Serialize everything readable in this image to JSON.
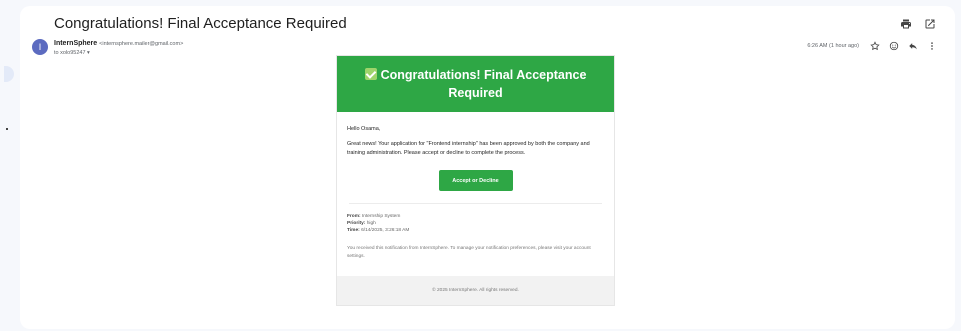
{
  "mail": {
    "subject": "Congratulations! Final Acceptance Required",
    "sender_name": "InternSphere",
    "sender_email": "<internsphere.mailer@gmail.com>",
    "avatar_letter": "I",
    "to_line": "to xolo95247 ▾",
    "timestamp": "6:26 AM (1 hour ago)"
  },
  "icons": {
    "print": "print-icon",
    "open_new": "open-in-new-window-icon",
    "star": "star-icon",
    "emoji": "emoji-icon",
    "reply": "reply-icon",
    "more": "more-vert-icon"
  },
  "email": {
    "header_title": "Congratulations! Final Acceptance Required",
    "greeting": "Hello Osama,",
    "message": "Great news! Your application for \"Frontend internship\" has been approved by both the company and training administration. Please accept or decline to complete the process.",
    "cta_label": "Accept or Decline",
    "from_label": "From:",
    "from_value": "Internship System",
    "priority_label": "Priority:",
    "priority_value": "high",
    "time_label": "Time:",
    "time_value": "6/14/2025, 3:26:18 AM",
    "note": "You received this notification from InternSphere. To manage your notification preferences, please visit your account settings.",
    "footer": "© 2025 InternSphere. All rights reserved."
  },
  "colors": {
    "brand_green": "#2ea745",
    "avatar": "#5c6bc0"
  }
}
